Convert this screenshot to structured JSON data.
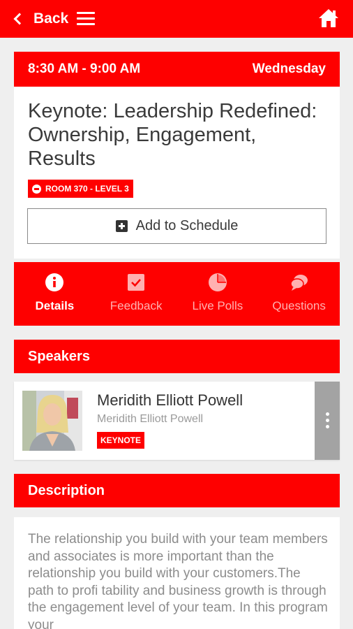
{
  "header": {
    "back_label": "Back"
  },
  "session": {
    "time": "8:30 AM - 9:00 AM",
    "day": "Wednesday",
    "title": "Keynote: Leadership Redefined: Ownership, Engagement, Results",
    "room": "ROOM 370 - LEVEL 3",
    "add_label": "Add to Schedule"
  },
  "tabs": [
    {
      "label": "Details",
      "icon": "info-icon",
      "active": true
    },
    {
      "label": "Feedback",
      "icon": "checkbox-icon",
      "active": false
    },
    {
      "label": "Live Polls",
      "icon": "pie-chart-icon",
      "active": false
    },
    {
      "label": "Questions",
      "icon": "chat-bubbles-icon",
      "active": false
    }
  ],
  "speakers": {
    "heading": "Speakers",
    "items": [
      {
        "name": "Meridith Elliott Powell",
        "subtitle": "Meridith Elliott Powell",
        "role": "KEYNOTE"
      }
    ]
  },
  "description": {
    "heading": "Description",
    "text": "The relationship you build with your team members and associates is more important than the relationship you build with your customers.The path to profi tability and business growth is through the engagement level of your team. In this program your"
  },
  "colors": {
    "accent": "#fe0000",
    "inactive_tab": "#ffb0b0",
    "more_menu": "#a3a3a3"
  }
}
